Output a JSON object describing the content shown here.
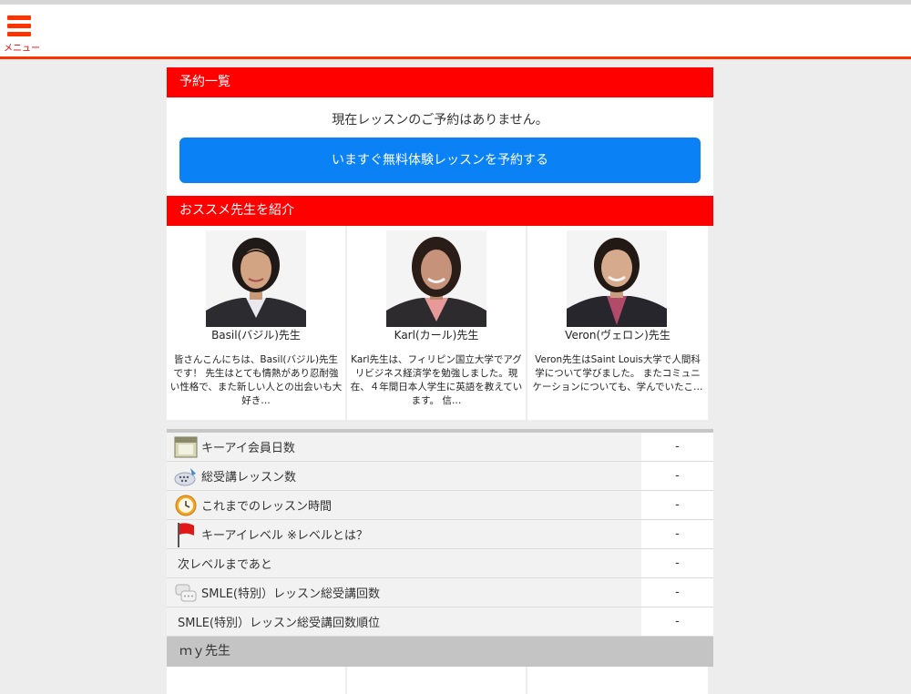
{
  "header": {
    "menu_label": "メニュー"
  },
  "reservations": {
    "title": "予約一覧",
    "empty_message": "現在レッスンのご予約はありません。",
    "cta_label": "いますぐ無料体験レッスンを予約する"
  },
  "recommended": {
    "title": "おススメ先生を紹介",
    "teachers": [
      {
        "name": "Basil(バジル)先生",
        "description": "皆さんこんにちは、Basil(バジル)先生です！ 先生はとても情熱があり忍耐強い性格で、また新しい人との出会いも大好き…"
      },
      {
        "name": "Karl(カール)先生",
        "description": "Karl先生は、フィリピン国立大学でアグリビジネス経済学を勉強しました。現在、４年間日本人学生に英語を教えています。 信…"
      },
      {
        "name": "Veron(ヴェロン)先生",
        "description": "Veron先生はSaint Louis大学で人間科学について学びました。 またコミュニケーションについても、学んでいたこ…"
      }
    ]
  },
  "stats": [
    {
      "label": "キーアイ会員日数",
      "value": "-",
      "icon": "calendar-icon"
    },
    {
      "label": "総受講レッスン数",
      "value": "-",
      "icon": "keyboard-icon"
    },
    {
      "label": "これまでのレッスン時間",
      "value": "-",
      "icon": "clock-icon"
    },
    {
      "label": "キーアイレベル ※レベルとは？",
      "value": "-",
      "icon": "flag-icon"
    },
    {
      "label": "次レベルまであと",
      "value": "-",
      "icon": ""
    },
    {
      "label": "SMLE(特別）レッスン総受講回数",
      "value": "-",
      "icon": "chat-bubbles-icon"
    },
    {
      "label": "SMLE(特別）レッスン総受講回数順位",
      "value": "-",
      "icon": ""
    }
  ],
  "my_teachers": {
    "title": "ｍｙ先生"
  },
  "colors": {
    "accent_red": "#ff0000",
    "header_border": "#ff3300",
    "cta_blue": "#0a82f5"
  }
}
